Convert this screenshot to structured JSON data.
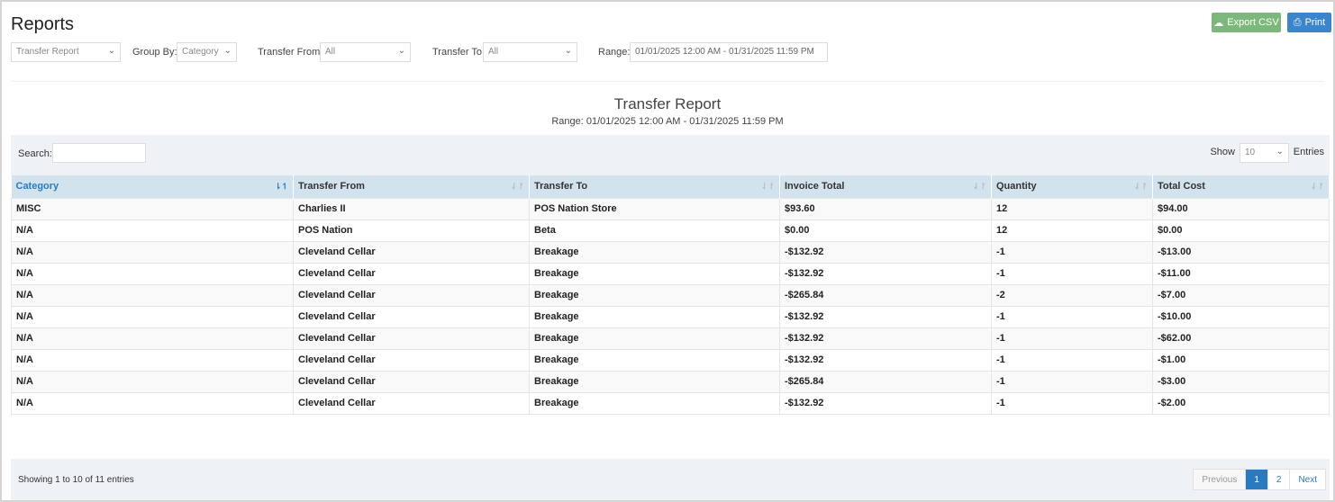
{
  "header": {
    "title": "Reports",
    "export_label": "Export CSV",
    "print_label": "Print",
    "export_color": "#7cb87c",
    "print_color": "#3a85cc"
  },
  "filters": {
    "report": "Transfer Report",
    "group_by_label": "Group By:",
    "group_by": "Category",
    "from_label": "Transfer From:",
    "from": "All",
    "to_label": "Transfer To:",
    "to": "All",
    "range_label": "Range:",
    "range": "01/01/2025 12:00 AM - 01/31/2025 11:59 PM"
  },
  "report": {
    "title": "Transfer Report",
    "subtitle": "Range: 01/01/2025 12:00 AM - 01/31/2025 11:59 PM"
  },
  "controls": {
    "search_label": "Search:",
    "search_value": "",
    "show_label": "Show",
    "show_value": "10",
    "entries_label": "Entries"
  },
  "table": {
    "columns": [
      "Category",
      "Transfer From",
      "Transfer To",
      "Invoice Total",
      "Quantity",
      "Total Cost"
    ],
    "rows": [
      [
        "MISC",
        "Charlies II",
        "POS Nation Store",
        "$93.60",
        "12",
        "$94.00"
      ],
      [
        "N/A",
        "POS Nation",
        "Beta",
        "$0.00",
        "12",
        "$0.00"
      ],
      [
        "N/A",
        "Cleveland Cellar",
        "Breakage",
        "-$132.92",
        "-1",
        "-$13.00"
      ],
      [
        "N/A",
        "Cleveland Cellar",
        "Breakage",
        "-$132.92",
        "-1",
        "-$11.00"
      ],
      [
        "N/A",
        "Cleveland Cellar",
        "Breakage",
        "-$265.84",
        "-2",
        "-$7.00"
      ],
      [
        "N/A",
        "Cleveland Cellar",
        "Breakage",
        "-$132.92",
        "-1",
        "-$10.00"
      ],
      [
        "N/A",
        "Cleveland Cellar",
        "Breakage",
        "-$132.92",
        "-1",
        "-$62.00"
      ],
      [
        "N/A",
        "Cleveland Cellar",
        "Breakage",
        "-$132.92",
        "-1",
        "-$1.00"
      ],
      [
        "N/A",
        "Cleveland Cellar",
        "Breakage",
        "-$265.84",
        "-1",
        "-$3.00"
      ],
      [
        "N/A",
        "Cleveland Cellar",
        "Breakage",
        "-$132.92",
        "-1",
        "-$2.00"
      ]
    ]
  },
  "footer": {
    "info": "Showing 1 to 10 of 11 entries",
    "previous": "Previous",
    "pages": [
      "1",
      "2"
    ],
    "current_page": "1",
    "next": "Next"
  }
}
